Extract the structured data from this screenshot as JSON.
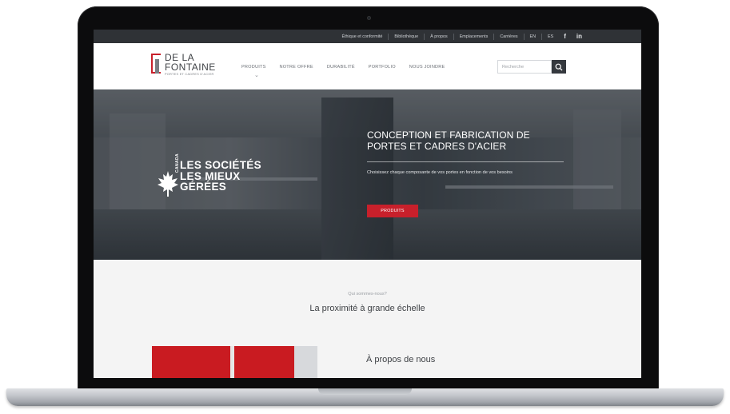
{
  "topbar": {
    "links": [
      "Éthique et conformité",
      "Bibliothèque",
      "À propos",
      "Emplacements",
      "Carrières",
      "EN",
      "ES"
    ],
    "social": [
      "f",
      "in"
    ]
  },
  "nav": {
    "logo": {
      "line1": "DE LA",
      "line2": "FONTAINE",
      "line3": "PORTES ET CADRES D'ACIER"
    },
    "items": [
      "PRODUITS",
      "NOTRE OFFRE",
      "DURABILITÉ",
      "PORTFOLIO",
      "NOUS JOINDRE"
    ],
    "search_placeholder": "Recherche"
  },
  "hero": {
    "award": {
      "country": "CANADA",
      "line1": "LES SOCIÉTÉS",
      "line2": "LES MIEUX",
      "line3": "GÉRÉES"
    },
    "title": "CONCEPTION ET FABRICATION DE PORTES ET CADRES D'ACIER",
    "subtitle": "Choisissez chaque composante de vos portes en fonction de vos besoins",
    "cta_label": "PRODUITS"
  },
  "intro": {
    "eyebrow": "Qui sommes-nous?",
    "tagline": "La proximité à grande échelle"
  },
  "about": {
    "title": "À propos de nous"
  },
  "colors": {
    "brand_red": "#c8202b",
    "dark_bar": "#2f3236",
    "text_dark": "#3f4246"
  }
}
